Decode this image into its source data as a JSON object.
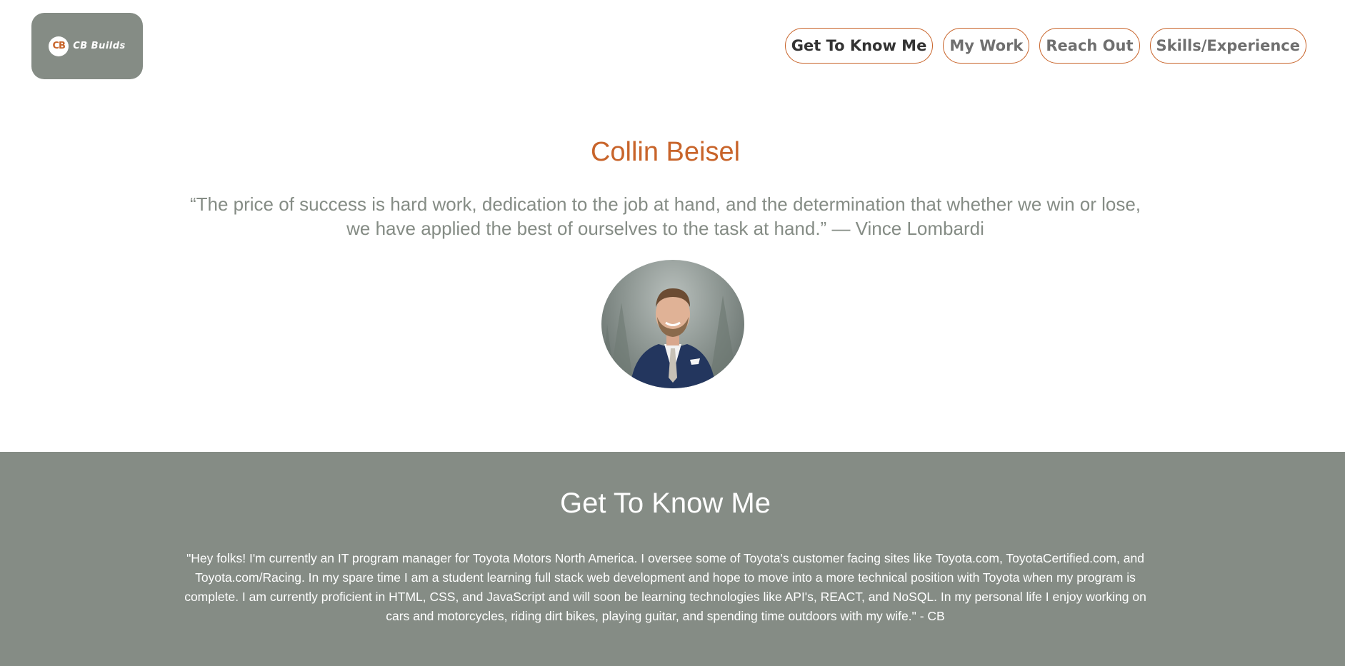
{
  "logo": {
    "badge": "CB",
    "text": "CB Builds"
  },
  "nav": {
    "items": [
      {
        "label": "Get To Know Me"
      },
      {
        "label": "My Work"
      },
      {
        "label": "Reach Out"
      },
      {
        "label": "Skills/Experience"
      }
    ]
  },
  "hero": {
    "name": "Collin Beisel",
    "quote": "“The price of success is hard work, dedication to the job at hand, and the determination that whether we win or lose, we have applied the best of ourselves to the task at hand.” — Vince Lombardi"
  },
  "about": {
    "title": "Get To Know Me",
    "text": "\"Hey folks! I'm currently an IT program manager for Toyota Motors North America. I oversee some of Toyota's customer facing sites like Toyota.com, ToyotaCertified.com, and Toyota.com/Racing. In my spare time I am a student learning full stack web development and hope to move into a more technical position with Toyota when my program is complete. I am currently proficient in HTML, CSS, and JavaScript and will soon be learning technologies like API's, REACT, and NoSQL. In my personal life I enjoy working on cars and motorcycles, riding dirt bikes, playing guitar, and spending time outdoors with my wife.\" - CB"
  },
  "colors": {
    "accent": "#c8642a",
    "sage": "#858c85",
    "white": "#ffffff"
  },
  "icons": {
    "logo": "cb-builds-logo-icon",
    "avatar": "profile-photo"
  }
}
